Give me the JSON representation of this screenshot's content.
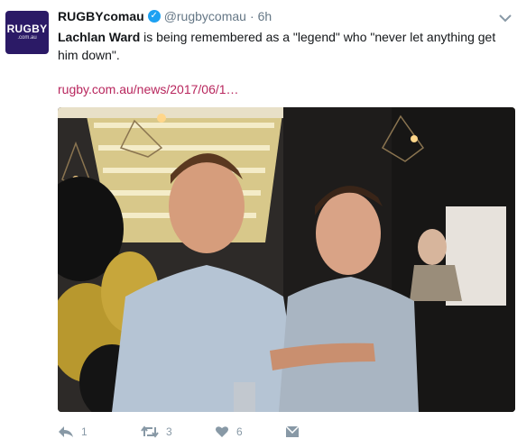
{
  "account": {
    "avatar_text": "RUGBY",
    "avatar_sub": ".com.au",
    "display_name": "RUGBYcomau",
    "handle": "@rugbycomau",
    "separator": "·",
    "time": "6h"
  },
  "tweet": {
    "name_highlight": "Lachlan Ward",
    "text": " is being remembered as a \"legend\" who \"never let anything get him down\".",
    "link": "rugby.com.au/news/2017/06/1…"
  },
  "actions": {
    "reply_count": "1",
    "retweet_count": "3",
    "like_count": "6"
  },
  "colors": {
    "brand": "#2b1a66",
    "link": "#b8265d",
    "verified": "#1da1f2",
    "muted": "#8899a6"
  },
  "icons": [
    "reply-icon",
    "retweet-icon",
    "heart-icon",
    "direct-message-icon",
    "chevron-down-icon",
    "verified-badge-icon"
  ]
}
